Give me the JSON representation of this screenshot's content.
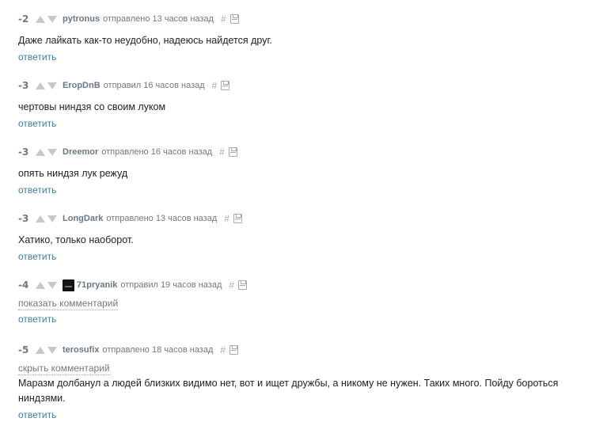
{
  "comments": [
    {
      "score": "-2",
      "author": "pytronus",
      "posted": "отправлено 13 часов назад",
      "hash": "#",
      "text": "Даже лайкать как-то неудобно, надеюсь найдется друг.",
      "reply": "ответить"
    },
    {
      "score": "-3",
      "author": "EropDnB",
      "posted": "отправил 16 часов назад",
      "hash": "#",
      "text": "чертовы ниндзя со своим луком",
      "reply": "ответить"
    },
    {
      "score": "-3",
      "author": "Dreemor",
      "posted": "отправлено 16 часов назад",
      "hash": "#",
      "text": "опять ниндзя лук режуд",
      "reply": "ответить"
    },
    {
      "score": "-3",
      "author": "LongDark",
      "posted": "отправлено 13 часов назад",
      "hash": "#",
      "text": "Хатико, только наоборот.",
      "reply": "ответить"
    },
    {
      "score": "-4",
      "author": "71pryanik",
      "posted": "отправил 19 часов назад",
      "hash": "#",
      "toggle": "показать комментарий",
      "reply": "ответить"
    },
    {
      "score": "-5",
      "author": "terosufix",
      "posted": "отправлено 18 часов назад",
      "hash": "#",
      "toggle": "скрыть комментарий",
      "text": "Маразм долбанул а людей близких видимо нет, вот и ищет дружбы, а никому не нужен. Таких много. Пойду бороться ниндзями.",
      "reply": "ответить"
    }
  ]
}
